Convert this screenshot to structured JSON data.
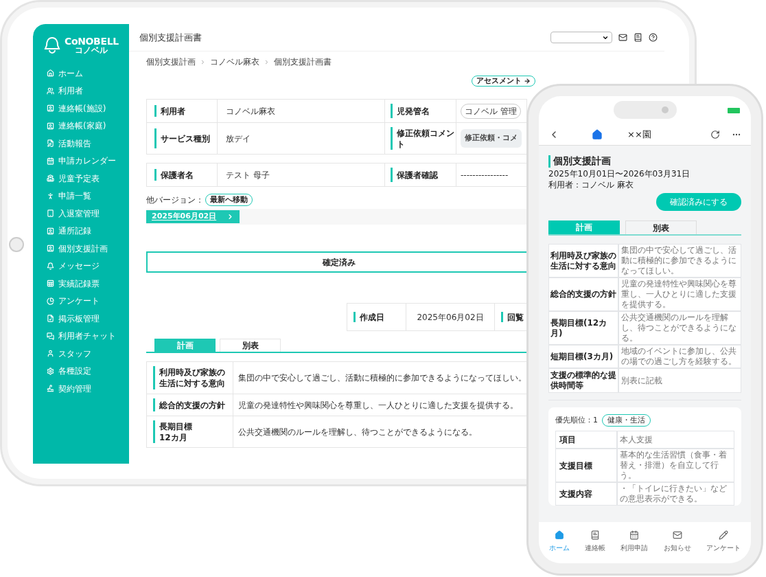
{
  "tablet": {
    "logo": {
      "name": "CoNOBELL",
      "subtitle": "コノベル"
    },
    "sidebar": {
      "items": [
        {
          "label": "ホーム"
        },
        {
          "label": "利用者"
        },
        {
          "label": "連絡帳(施設)"
        },
        {
          "label": "連絡帳(家庭)"
        },
        {
          "label": "活動報告"
        },
        {
          "label": "申請カレンダー"
        },
        {
          "label": "児童予定表"
        },
        {
          "label": "申請一覧"
        },
        {
          "label": "入退室管理"
        },
        {
          "label": "通所記録"
        },
        {
          "label": "個別支援計画"
        },
        {
          "label": "メッセージ"
        },
        {
          "label": "実績記録票"
        },
        {
          "label": "アンケート"
        },
        {
          "label": "掲示板管理"
        },
        {
          "label": "利用者チャット"
        },
        {
          "label": "スタッフ"
        },
        {
          "label": "各種設定"
        },
        {
          "label": "契約管理"
        }
      ]
    },
    "header": {
      "title": "個別支援計画書"
    },
    "breadcrumb": [
      "個別支援計画",
      "コノベル麻衣",
      "個別支援計画書"
    ],
    "assessment_button": "アセスメント",
    "info_tables": [
      [
        {
          "label": "利用者",
          "value": "コノベル麻衣",
          "label_2": "児発管名",
          "value_2": "コノベル 管理",
          "kind": "outlined"
        },
        {
          "label": "サービス種別",
          "value": "放デイ",
          "label_2": "修正依頼コメント",
          "value_2": "修正依頼・コメ",
          "kind": "filled"
        }
      ],
      [
        {
          "label": "保護者名",
          "value": "テスト 母子",
          "label_2": "保護者確認",
          "value_2": "----------------",
          "kind": "text"
        }
      ]
    ],
    "versions": {
      "label": "他バージョン：",
      "latest_button": "最新へ移動",
      "date": "2025年06月02日"
    },
    "status": "確定済み",
    "meta": [
      {
        "label": "作成日",
        "value": "2025年06月02日"
      },
      {
        "label": "回覧"
      }
    ],
    "tabs": [
      {
        "label": "計画",
        "selected": true
      },
      {
        "label": "別表",
        "selected": false
      }
    ],
    "plan_rows": [
      {
        "label": "利用時及び家族の生活に対する意向",
        "value": "集団の中で安心して過ごし、活動に積極的に参加できるようになってほしい。"
      },
      {
        "label": "総合的支援の方針",
        "value": "児童の発達特性や興味関心を尊重し、一人ひとりに適した支援を提供する。"
      },
      {
        "label": "長期目標\n12カ月",
        "value": "公共交通機関のルールを理解し、待つことができるようになる。"
      }
    ]
  },
  "phone": {
    "nav": {
      "title": "××園"
    },
    "plan": {
      "title": "個別支援計画",
      "period": "2025年10月01日〜2026年03月31日",
      "user": "利用者：コノベル 麻衣",
      "confirm_button": "確認済みにする"
    },
    "tabs": [
      {
        "label": "計画",
        "selected": true
      },
      {
        "label": "別表",
        "selected": false
      }
    ],
    "rows": [
      {
        "label": "利用時及び家族の生活に対する意向",
        "value": "集団の中で安心して過ごし、活動に積極的に参加できるようになってほしい。"
      },
      {
        "label": "総合的支援の方針",
        "value": "児童の発達特性や興味関心を尊重し、一人ひとりに適した支援を提供する。"
      },
      {
        "label": "長期目標(12カ月)",
        "value": "公共交通機関のルールを理解し、待つことができるようになる。"
      },
      {
        "label": "短期目標(3カ月)",
        "value": "地域のイベントに参加し、公共の場での過ごし方を経験する。"
      },
      {
        "label": "支援の標準的な提供時間等",
        "value": "別表に記載"
      }
    ],
    "priority": {
      "label": "優先順位：1",
      "tag": "健康・生活"
    },
    "detail_rows": [
      {
        "label": "項目",
        "value": "本人支援"
      },
      {
        "label": "支援目標",
        "value": "基本的な生活習慣（食事・着替え・排泄）を自立して行う。"
      },
      {
        "label": "支援内容",
        "value": "・「トイレに行きたい」などの意思表示ができる。"
      }
    ],
    "bottom_nav": [
      {
        "label": "ホーム",
        "selected": true
      },
      {
        "label": "連絡帳",
        "selected": false
      },
      {
        "label": "利用申請",
        "selected": false
      },
      {
        "label": "お知らせ",
        "selected": false
      },
      {
        "label": "アンケート",
        "selected": false
      }
    ]
  }
}
